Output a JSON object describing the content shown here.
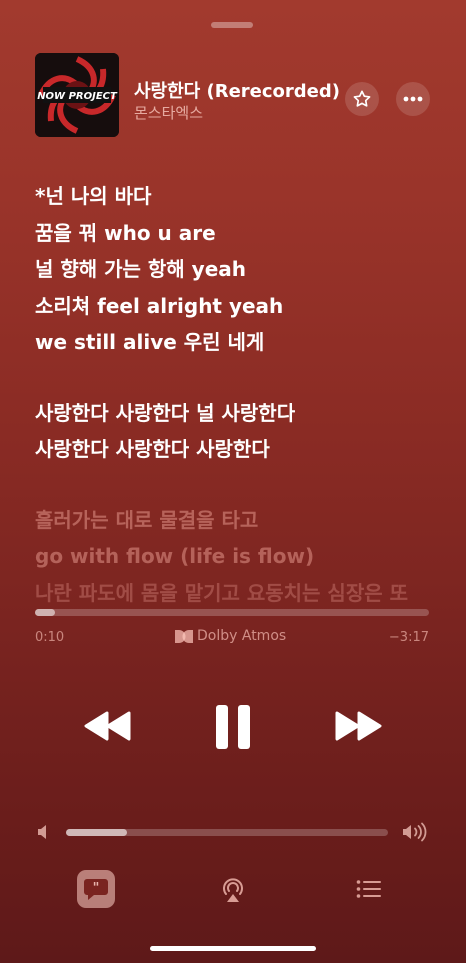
{
  "now_playing": {
    "title": "사랑한다 (Rerecorded)",
    "artist": "몬스타엑스",
    "artwork_text": "NOW PROJECT"
  },
  "lyrics": [
    {
      "text": "*넌 나의 바다",
      "state": "active"
    },
    {
      "text": "꿈을 꿔 who u are",
      "state": "active"
    },
    {
      "text": "널 향해 가는 항해 yeah",
      "state": "active"
    },
    {
      "text": "소리쳐 feel alright yeah",
      "state": "active"
    },
    {
      "text": "we still alive 우린 네게",
      "state": "active"
    },
    {
      "gap": true
    },
    {
      "text": "사랑한다 사랑한다 널 사랑한다",
      "state": "active"
    },
    {
      "text": "사랑한다 사랑한다 사랑한다",
      "state": "active"
    },
    {
      "gap": true
    },
    {
      "text": "흘러가는 대로 물결을 타고",
      "state": "dim"
    },
    {
      "text": "go with flow (life is flow)",
      "state": "dim"
    },
    {
      "text": "나란 파도에 몸을 맡기고 요동치는 심장은 또",
      "state": "dimmer"
    }
  ],
  "playback": {
    "elapsed": "0:10",
    "remaining": "−3:17",
    "progress_fraction": 0.05,
    "audio_format": "Dolby Atmos",
    "is_playing": true
  },
  "volume": {
    "level_fraction": 0.19
  },
  "icons": {
    "star": "star-icon",
    "more": "ellipsis-icon",
    "rewind": "rewind-icon",
    "pause": "pause-icon",
    "forward": "fast-forward-icon",
    "volume_low": "speaker-low-icon",
    "volume_high": "speaker-high-icon",
    "lyrics": "lyrics-quote-icon",
    "airplay": "airplay-icon",
    "queue": "queue-list-icon",
    "dolby": "dolby-icon"
  },
  "colors": {
    "accent": "#9a342a",
    "lyrics_button_bg": "#d9a39a"
  }
}
